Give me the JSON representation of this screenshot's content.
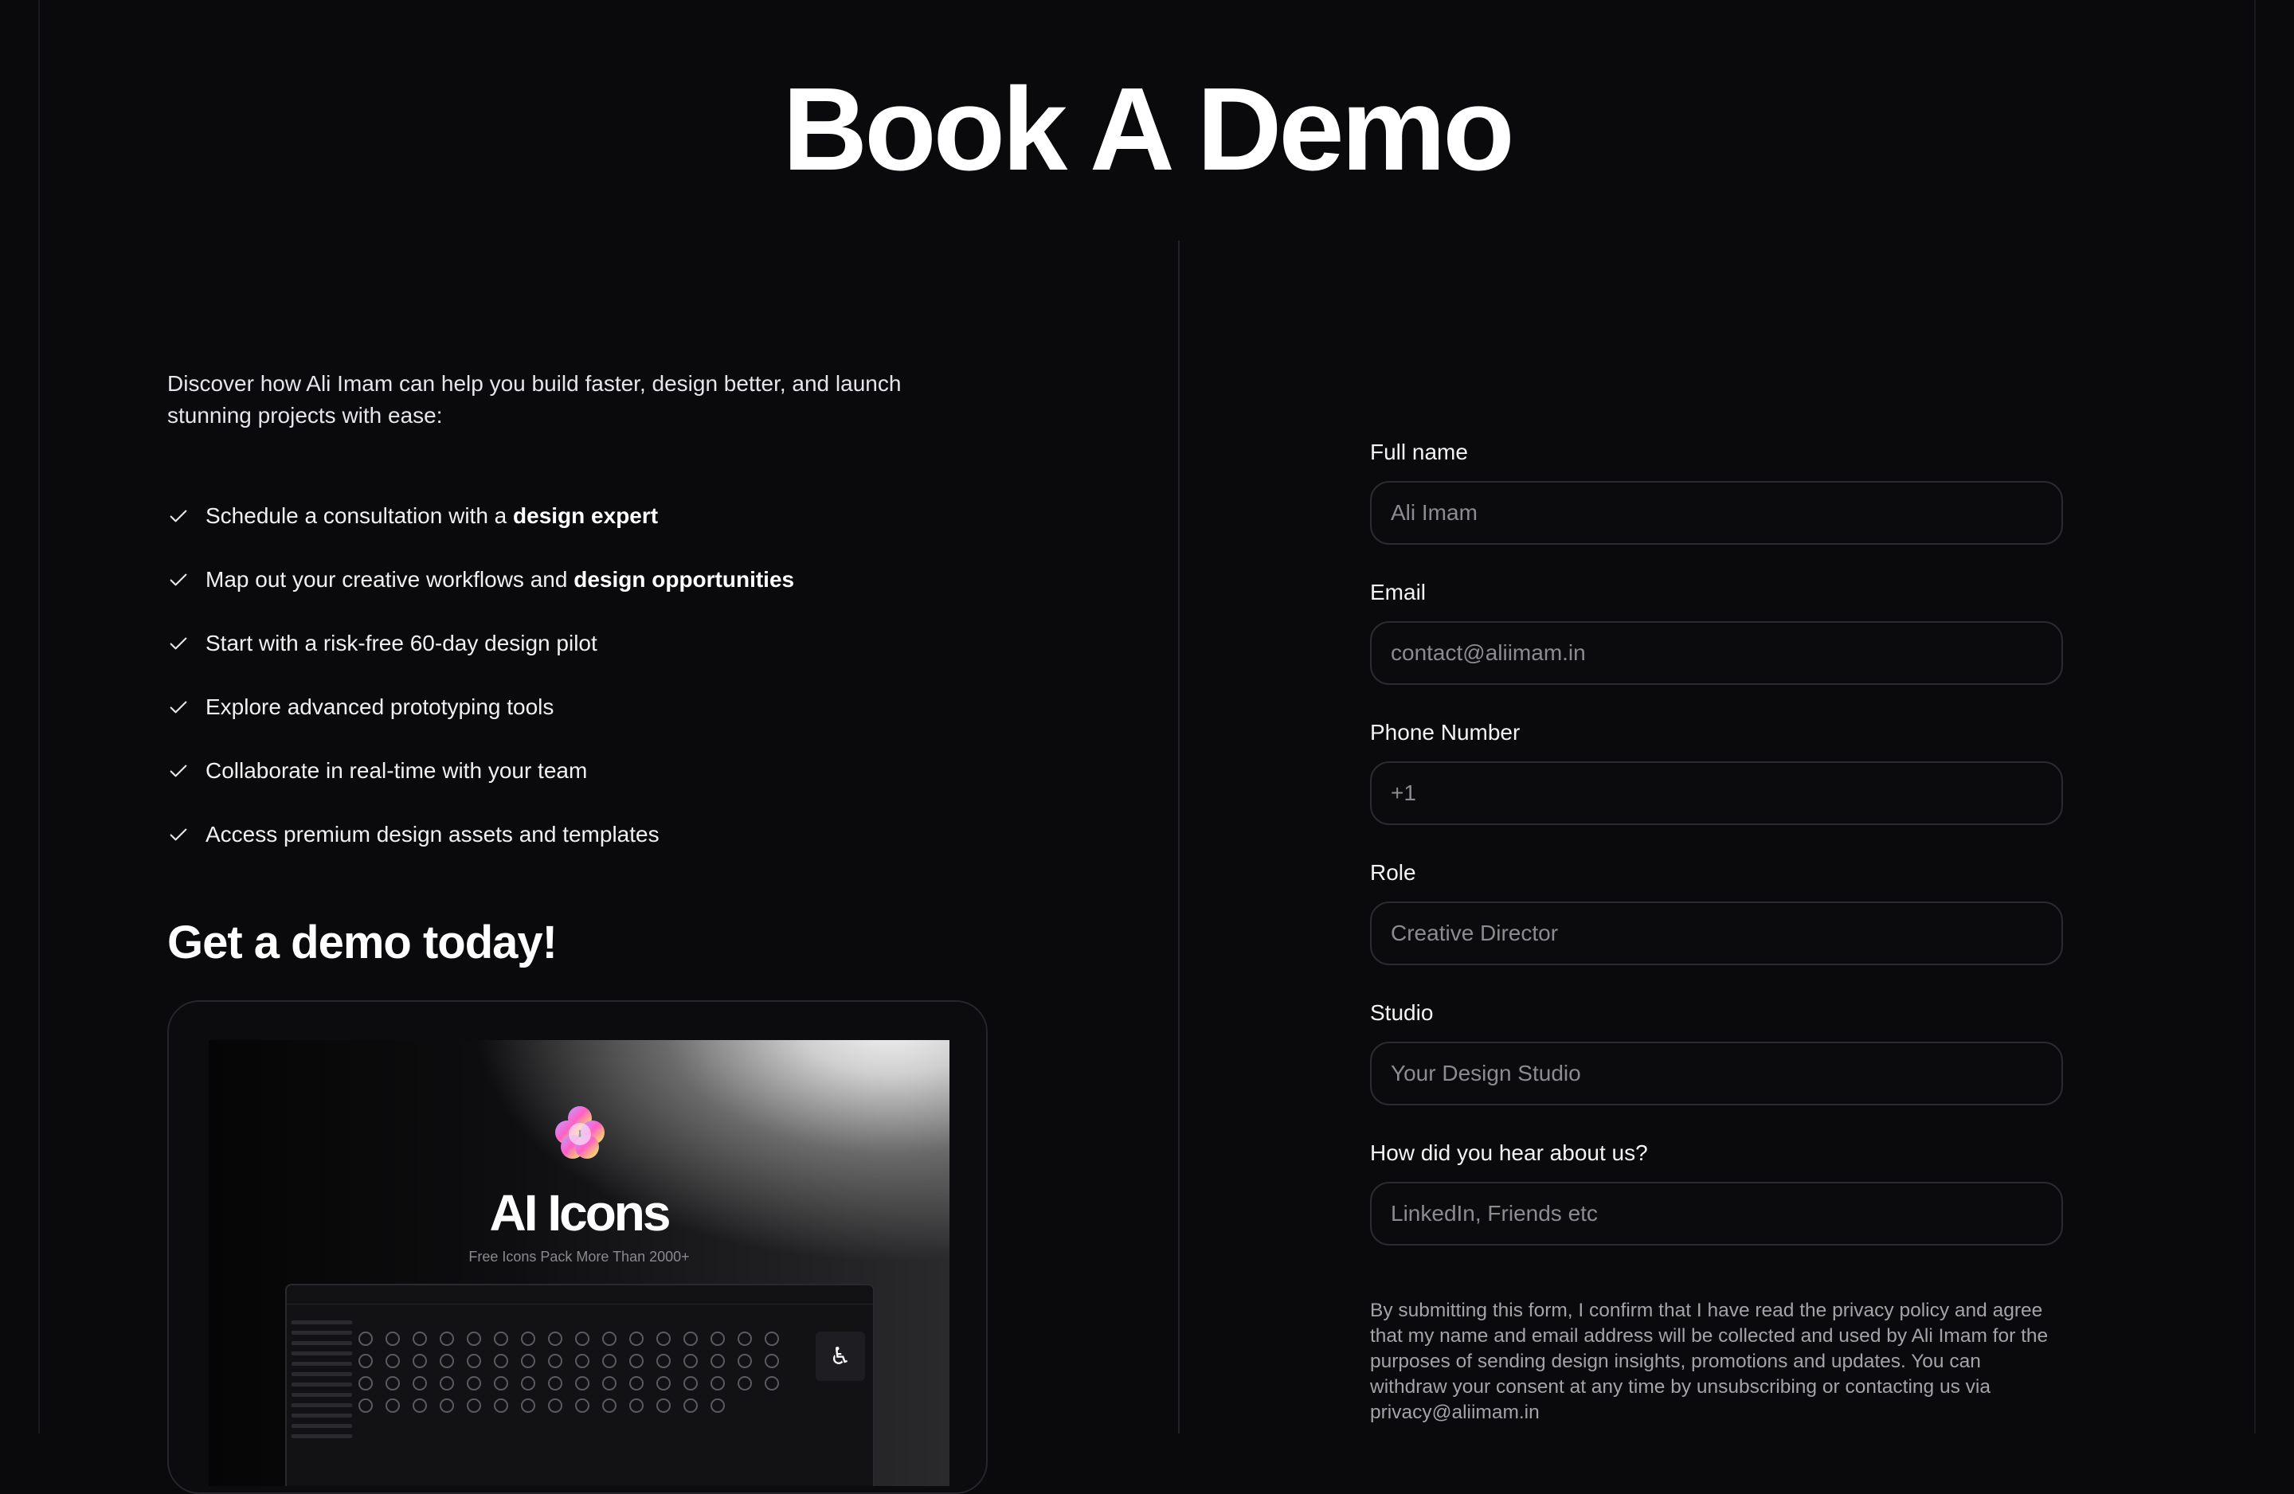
{
  "page": {
    "title": "Book A Demo"
  },
  "left": {
    "intro": "Discover how Ali Imam can help you build faster, design better, and launch stunning projects with ease:",
    "features": [
      {
        "text": "Schedule a consultation with a ",
        "bold": "design expert"
      },
      {
        "text": "Map out your creative workflows and ",
        "bold": "design opportunities"
      },
      {
        "text": "Start with a risk-free 60-day design pilot",
        "bold": ""
      },
      {
        "text": "Explore advanced prototyping tools",
        "bold": ""
      },
      {
        "text": "Collaborate in real-time with your team",
        "bold": ""
      },
      {
        "text": "Access premium design assets and templates",
        "bold": ""
      }
    ],
    "demo_heading": "Get a demo today!",
    "preview": {
      "title": "AI Icons",
      "subtitle": "Free Icons Pack More Than 2000+"
    }
  },
  "form": {
    "fields": [
      {
        "label": "Full name",
        "placeholder": "Ali Imam"
      },
      {
        "label": "Email",
        "placeholder": "contact@aliimam.in"
      },
      {
        "label": "Phone Number",
        "placeholder": "+1"
      },
      {
        "label": "Role",
        "placeholder": "Creative Director"
      },
      {
        "label": "Studio",
        "placeholder": "Your Design Studio"
      },
      {
        "label": "How did you hear about us?",
        "placeholder": "LinkedIn, Friends etc"
      }
    ],
    "consent": "By submitting this form, I confirm that I have read the privacy policy and agree that my name and email address will be collected and used by Ali Imam for the purposes of sending design insights, promotions and updates. You can withdraw your consent at any time by unsubscribing or contacting us via privacy@aliimam.in"
  },
  "icons": {
    "check": "check-icon",
    "logo": "flower-logo-icon",
    "accessibility": "accessibility-icon"
  },
  "colors": {
    "background": "#0a0a0c",
    "text": "#ffffff",
    "muted": "#8c8c90",
    "border": "#2b2b30"
  }
}
